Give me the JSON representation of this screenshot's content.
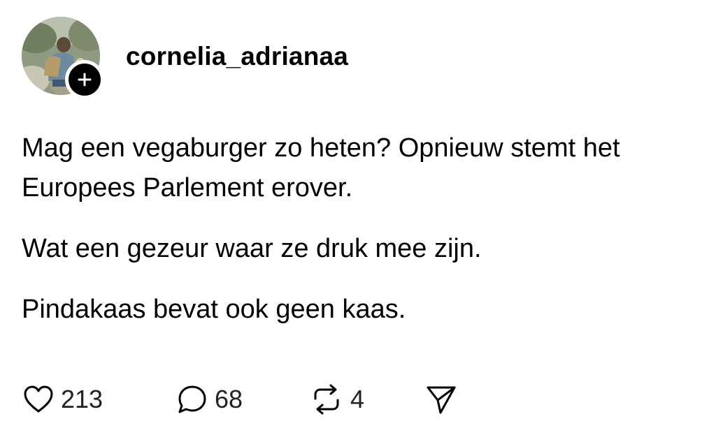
{
  "post": {
    "username": "cornelia_adrianaa",
    "paragraphs": [
      "Mag een vegaburger zo heten? Opnieuw stemt het Europees Parlement erover.",
      "Wat een gezeur waar ze druk mee zijn.",
      "Pindakaas bevat ook geen kaas."
    ],
    "actions": {
      "likes": "213",
      "replies": "68",
      "reposts": "4"
    }
  },
  "icons": {
    "follow": "plus-icon",
    "like": "heart-icon",
    "reply": "speech-bubble-icon",
    "repost": "repost-icon",
    "share": "send-icon"
  },
  "colors": {
    "text": "#000000",
    "background": "#ffffff",
    "badge": "#000000"
  }
}
